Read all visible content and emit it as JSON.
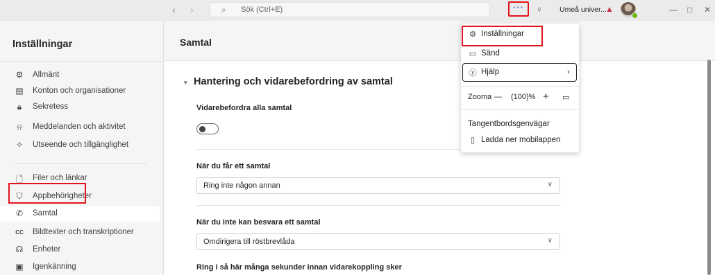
{
  "titlebar": {
    "search_placeholder": "Sök (Ctrl+E)",
    "more_label": "···",
    "org_name": "Umeå univer..."
  },
  "sidebar": {
    "title": "Inställningar",
    "items": [
      {
        "label": "Allmänt",
        "icon": "gear-icon"
      },
      {
        "label": "Konton och organisationer",
        "icon": "id-card-icon"
      },
      {
        "label": "Sekretess",
        "icon": "lock-icon"
      },
      {
        "label": "Meddelanden och aktivitet",
        "icon": "bell-icon"
      },
      {
        "label": "Utseende och tillgänglighet",
        "icon": "wand-icon"
      },
      {
        "label": "Filer och länkar",
        "icon": "file-icon"
      },
      {
        "label": "Appbehörigheter",
        "icon": "shield-icon"
      },
      {
        "label": "Samtal",
        "icon": "phone-icon"
      },
      {
        "label": "Bildtexter och transkriptioner",
        "icon": "cc-icon"
      },
      {
        "label": "Enheter",
        "icon": "headset-icon"
      },
      {
        "label": "Igenkänning",
        "icon": "recognition-icon"
      }
    ]
  },
  "main": {
    "title": "Samtal",
    "section_title": "Hantering och vidarebefordring av samtal",
    "forward_all_label": "Vidarebefordra alla samtal",
    "forward_all_on": false,
    "when_call_label": "När du får ett samtal",
    "when_call_value": "Ring inte någon annan",
    "when_unavailable_label": "När du inte kan besvara ett samtal",
    "when_unavailable_value": "Omdirigera till röstbrevlåda",
    "ring_seconds_label": "Ring i så här många sekunder innan vidarekoppling sker"
  },
  "menu": {
    "settings": "Inställningar",
    "cast": "Sänd",
    "help": "Hjälp",
    "zoom_label": "Zooma",
    "zoom_minus": "—",
    "zoom_value": "(100)%",
    "zoom_plus": "+",
    "shortcuts": "Tangentbordsgenvägar",
    "mobile": "Ladda ner mobilappen"
  },
  "colors": {
    "highlight_red": "#e0131b",
    "accent": "#5b5fc7",
    "status_green": "#6bb700"
  }
}
